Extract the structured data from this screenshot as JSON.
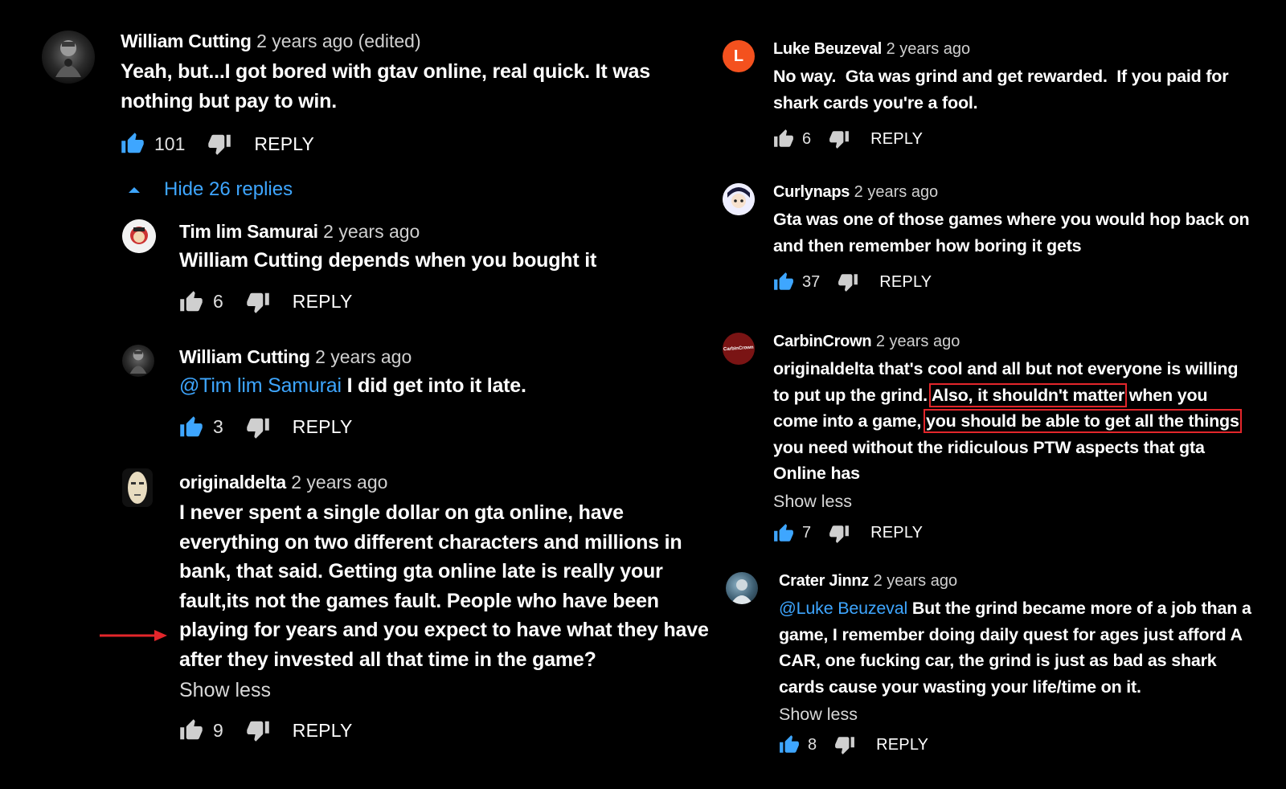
{
  "colors": {
    "link": "#3ea6ff",
    "highlight": "#e3262b",
    "like_active": "#3ea6ff"
  },
  "left": {
    "top_comment": {
      "author": "William Cutting",
      "time": "2 years ago (edited)",
      "text": "Yeah, but...I got bored with gtav online, real quick. It was nothing but pay to win.",
      "likes": "101",
      "reply_label": "REPLY"
    },
    "hide_replies": {
      "label": "Hide 26 replies",
      "icon": "caret-up-icon"
    },
    "replies": [
      {
        "author": "Tim lim Samurai",
        "time": "2 years ago",
        "text": "William Cutting depends when you bought it",
        "likes": "6",
        "reply_label": "REPLY"
      },
      {
        "author": "William Cutting",
        "time": "2 years ago",
        "mention": "@Tim lim Samurai",
        "text": " I did get into it late.",
        "likes": "3",
        "reply_label": "REPLY"
      },
      {
        "author": "originaldelta",
        "time": "2 years ago",
        "text": "I never spent a single dollar on gta online, have everything on two different characters and millions in bank, that said. Getting gta online late is really your fault,its not the games fault. People who have been playing for years and you expect to have what they have after they invested all that time in the game?",
        "show_less": "Show less",
        "likes": "9",
        "reply_label": "REPLY"
      }
    ]
  },
  "right": {
    "comments": [
      {
        "author": "Luke Beuzeval",
        "time": "2 years ago",
        "avatar_letter": "L",
        "text": "No way.  Gta was grind and get rewarded.  If you paid for shark cards you're a fool.",
        "likes": "6",
        "reply_label": "REPLY"
      },
      {
        "author": "Curlynaps",
        "time": "2 years ago",
        "text": "Gta was one of those games where you would hop back on and then remember how boring it gets",
        "likes": "37",
        "reply_label": "REPLY"
      },
      {
        "author": "CarbinCrown",
        "time": "2 years ago",
        "avatar_text": "CarbinCrown",
        "text_a": "originaldelta that's cool and all but not everyone is willing to put up the grind. ",
        "highlight_1": "Also, it shouldn't matter",
        "text_b": " when you come into a game, ",
        "highlight_2": "you should be able to get all the things",
        "text_c": " you need without the ridiculous PTW aspects that gta Online has",
        "show_less": "Show less",
        "likes": "7",
        "reply_label": "REPLY"
      },
      {
        "author": "Crater Jinnz",
        "time": "2 years ago",
        "mention": "@Luke Beuzeval",
        "text": " But the grind became more of a job than a game, I remember doing daily quest for ages just afford A CAR, one fucking car, the grind is just as bad as shark cards cause your wasting your life/time on it.",
        "show_less": "Show less",
        "likes": "8",
        "reply_label": "REPLY"
      }
    ]
  }
}
